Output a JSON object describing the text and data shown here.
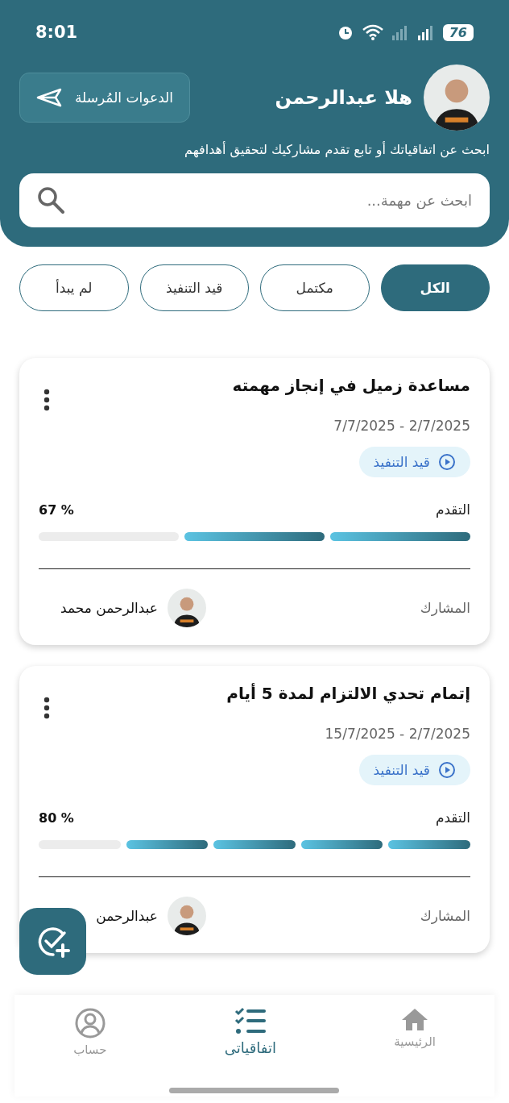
{
  "status_bar": {
    "time": "8:01",
    "battery": "76"
  },
  "header": {
    "greeting": "هلا عبدالرحمن",
    "invites_button": "الدعوات المُرسلة",
    "subtitle": "ابحث عن اتفاقياتك أو تابع تقدم مشاركيك لتحقيق أهدافهم",
    "search": {
      "placeholder": "ابحث عن مهمة..."
    }
  },
  "filters": [
    {
      "label": "الكل",
      "selected": true
    },
    {
      "label": "مكتمل",
      "selected": false
    },
    {
      "label": "قيد التنفيذ",
      "selected": false
    },
    {
      "label": "لم يبدأ",
      "selected": false
    }
  ],
  "agreements": [
    {
      "title": "مساعدة زميل في إنجاز مهمته",
      "dates": "7/7/2025 - 2/7/2025",
      "status": "قيد التنفيذ",
      "progress_label": "التقدم",
      "percent": "% 67",
      "steps": [
        {
          "filled": true
        },
        {
          "filled": true
        },
        {
          "filled": false
        }
      ],
      "participant_label": "المشارك",
      "participant": "عبدالرحمن محمد"
    },
    {
      "title": "إتمام تحدي الالتزام لمدة 5 أيام",
      "dates": "15/7/2025 - 2/7/2025",
      "status": "قيد التنفيذ",
      "progress_label": "التقدم",
      "percent": "% 80",
      "steps": [
        {
          "filled": true
        },
        {
          "filled": true
        },
        {
          "filled": true
        },
        {
          "filled": true
        },
        {
          "filled": false
        }
      ],
      "participant_label": "المشارك",
      "participant": "عبدالرحمن"
    }
  ],
  "bottom_nav": [
    {
      "kind": "home",
      "label": "الرئيسية",
      "selected": false
    },
    {
      "kind": "list",
      "label": "اتفاقياتى",
      "selected": true
    },
    {
      "kind": "account",
      "label": "حساب",
      "selected": false
    }
  ]
}
